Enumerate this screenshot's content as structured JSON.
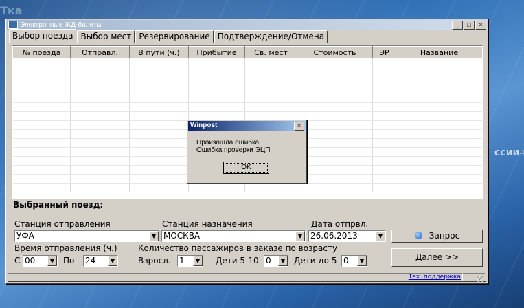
{
  "background": {
    "right_text": "ССИИ-Г",
    "left_text": "Тка"
  },
  "window": {
    "title": "Электронные ЖД-билеты",
    "controls": {
      "minimize": "_",
      "maximize": "□",
      "close": "×"
    }
  },
  "tabs": [
    {
      "label": "Выбор поезда"
    },
    {
      "label": "Выбор мест"
    },
    {
      "label": "Резервирование"
    },
    {
      "label": "Подтверждение/Отмена"
    }
  ],
  "table": {
    "columns": [
      "№ поезда",
      "Отправл.",
      "В пути (ч.)",
      "Прибытие",
      "Св. мест",
      "Стоимость",
      "ЭР",
      "Название"
    ]
  },
  "selected_train": {
    "title": "Выбранный поезд:"
  },
  "form": {
    "departure_label": "Станция отправления",
    "departure_value": "УФА",
    "destination_label": "Станция назначения",
    "destination_value": "МОСКВА",
    "date_label": "Дата отпрвл.",
    "date_value": "26.06.2013",
    "time_label": "Время отправления (ч.)",
    "from_label": "С",
    "from_value": "00",
    "to_label": "По",
    "to_value": "24",
    "passengers_label": "Количество пассажиров в заказе по возрасту",
    "adults_label": "Взросл.",
    "adults_value": "1",
    "kids_5_10_label": "Дети 5-10",
    "kids_5_10_value": "0",
    "kids_under5_label": "Дети до 5",
    "kids_under5_value": "0",
    "request_button": "Запрос",
    "next_button": "Далее >>"
  },
  "status": {
    "support_link": "Тех. поддержка"
  },
  "dialog": {
    "title": "Winpost",
    "close": "×",
    "line1": "Произошла ошибка:",
    "line2": "Ошибка проверки ЭЦП",
    "ok": "OK"
  }
}
